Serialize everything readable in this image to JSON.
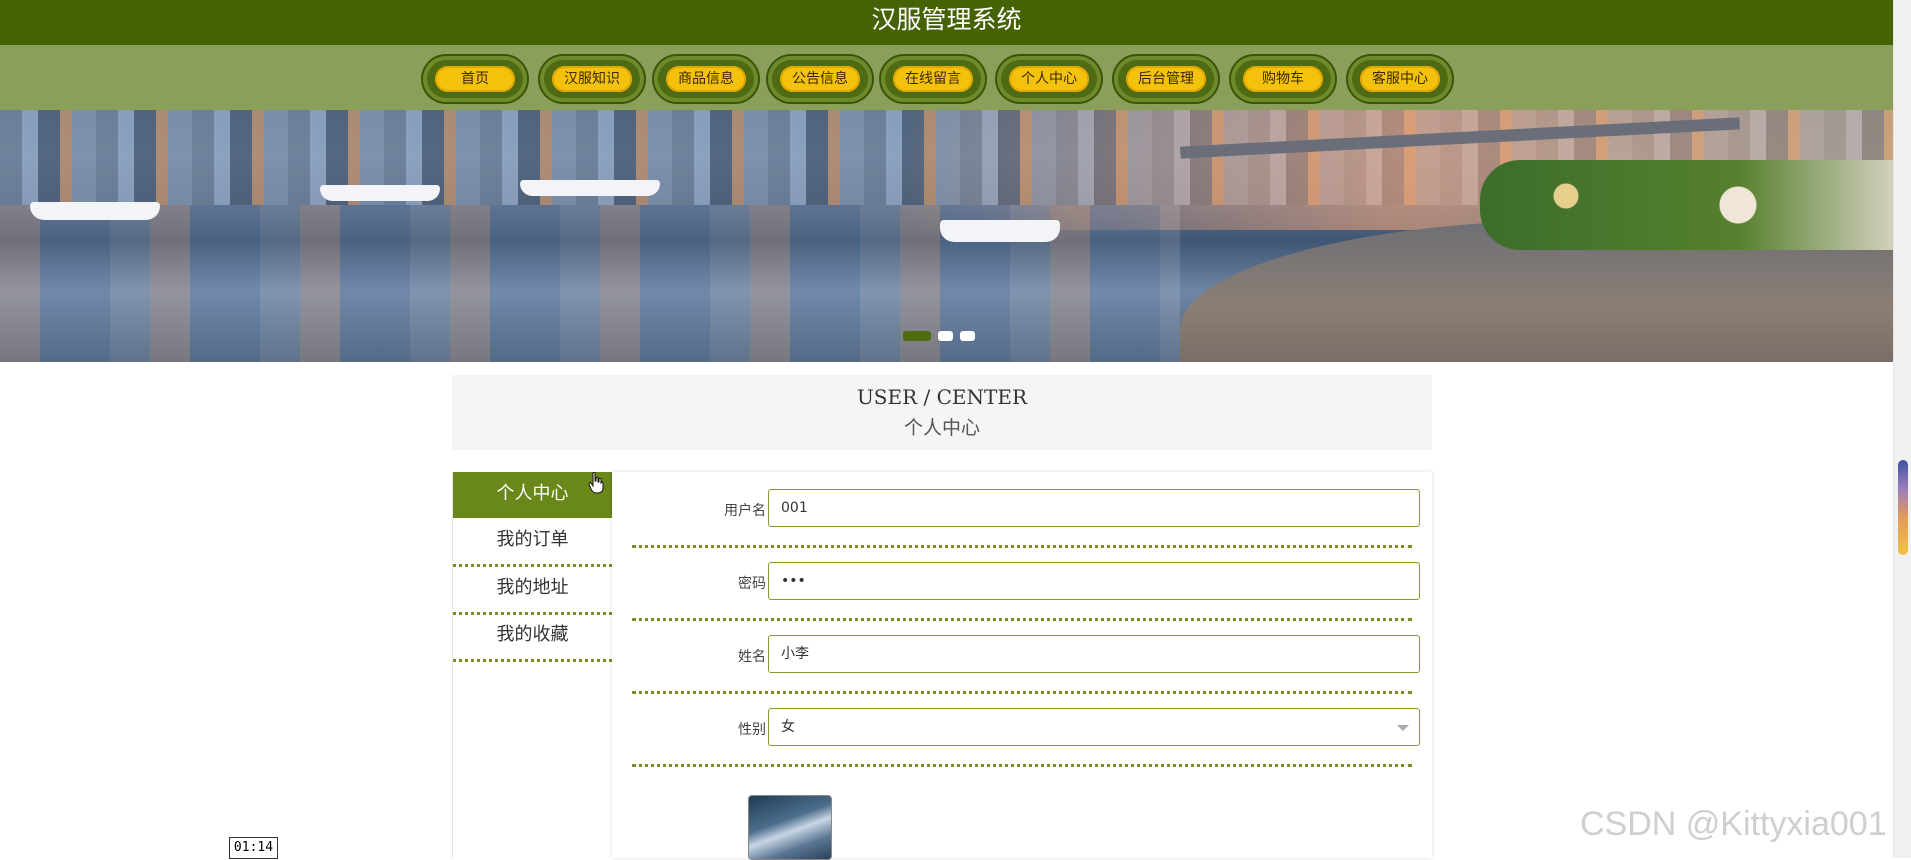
{
  "app": {
    "title": "汉服管理系统"
  },
  "nav": [
    {
      "label": "首页"
    },
    {
      "label": "汉服知识"
    },
    {
      "label": "商品信息"
    },
    {
      "label": "公告信息"
    },
    {
      "label": "在线留言"
    },
    {
      "label": "个人中心"
    },
    {
      "label": "后台管理"
    },
    {
      "label": "购物车"
    },
    {
      "label": "客服中心"
    }
  ],
  "banner": {
    "slides": 3,
    "active_slide": 1
  },
  "user_center": {
    "title_en": "USER / CENTER",
    "title_cn": "个人中心"
  },
  "sidebar": {
    "items": [
      {
        "label": "个人中心",
        "active": true
      },
      {
        "label": "我的订单"
      },
      {
        "label": "我的地址"
      },
      {
        "label": "我的收藏"
      }
    ]
  },
  "form": {
    "username": {
      "label": "用户名",
      "value": "001"
    },
    "password": {
      "label": "密码",
      "value": "•••"
    },
    "name": {
      "label": "姓名",
      "value": "小李"
    },
    "gender": {
      "label": "性别",
      "value": "女"
    }
  },
  "overlay": {
    "timer": "01:14",
    "watermark": "CSDN @Kittyxia001"
  },
  "colors": {
    "header": "#456204",
    "nav_band": "#8aa05a",
    "nav_pill": "#f4c20d",
    "accent": "#6a8719"
  }
}
